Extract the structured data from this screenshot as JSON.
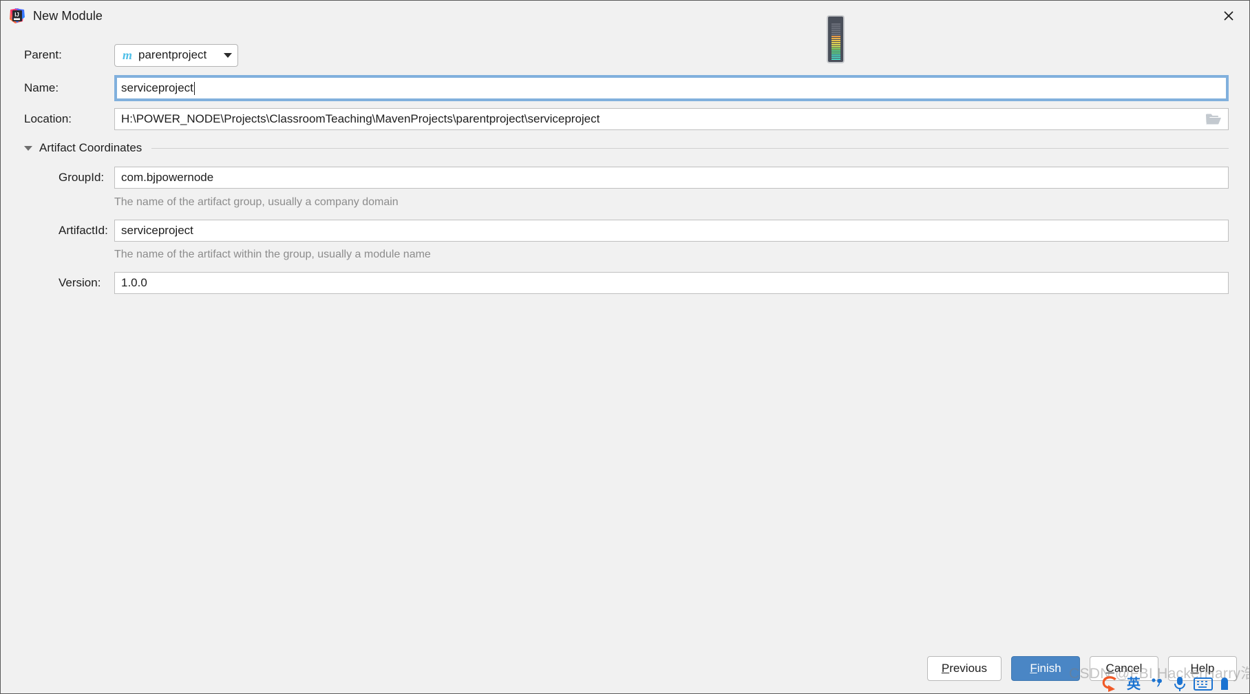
{
  "window": {
    "title": "New Module",
    "app_icon": "intellij-idea-logo",
    "close_icon": "close-icon"
  },
  "form": {
    "parent": {
      "label": "Parent:",
      "value": "parentproject",
      "icon": "maven-module-icon",
      "dropdown_icon": "chevron-down-icon"
    },
    "name": {
      "label": "Name:",
      "value": "serviceproject",
      "focused": true
    },
    "location": {
      "label": "Location:",
      "value": "H:\\POWER_NODE\\Projects\\ClassroomTeaching\\MavenProjects\\parentproject\\serviceproject",
      "browse_icon": "folder-icon"
    },
    "artifact_section": {
      "title": "Artifact Coordinates",
      "expanded": true,
      "collapse_icon": "triangle-down-icon"
    },
    "group_id": {
      "label": "GroupId:",
      "value": "com.bjpowernode",
      "hint": "The name of the artifact group, usually a company domain"
    },
    "artifact_id": {
      "label": "ArtifactId:",
      "value": "serviceproject",
      "hint": "The name of the artifact within the group, usually a module name"
    },
    "version": {
      "label": "Version:",
      "value": "1.0.0"
    }
  },
  "footer": {
    "previous": {
      "label": "Previous",
      "mnemonic": "P"
    },
    "finish": {
      "label": "Finish",
      "mnemonic": "F",
      "primary": true
    },
    "cancel": {
      "label": "Cancel",
      "mnemonic": "C"
    },
    "help": {
      "label": "Help",
      "mnemonic": "H"
    }
  },
  "overlays": {
    "watermark": "CSDN @FBI HackerHarry浩",
    "volume_osd": {
      "name": "volume-level-indicator",
      "segments": 18,
      "colors": [
        "#4ad6c0",
        "#4ad6c0",
        "#4ad6c0",
        "#5bd98a",
        "#5bd98a",
        "#8ede5e",
        "#c8e057",
        "#e2dd54",
        "#e8d24f",
        "#e9c44c",
        "#eab24a",
        "#e89a47",
        "#6b6f7a",
        "#6b6f7a",
        "#6b6f7a",
        "#6b6f7a",
        "#6b6f7a",
        "#6b6f7a"
      ]
    },
    "ime_toolbar": {
      "name": "sogou-ime-toolbar",
      "items": [
        "sogou-logo-icon",
        "english-mode-icon",
        "punctuation-icon",
        "voice-input-icon",
        "soft-keyboard-icon",
        "ime-more-icon"
      ]
    }
  },
  "colors": {
    "dialog_bg": "#f1f1f1",
    "field_bg": "#ffffff",
    "focus_ring": "#81b0dd",
    "primary_button": "#4a86c5",
    "text": "#1d1d1d",
    "hint_text": "#8c8c8c",
    "maven_icon": "#4fbfe8"
  }
}
